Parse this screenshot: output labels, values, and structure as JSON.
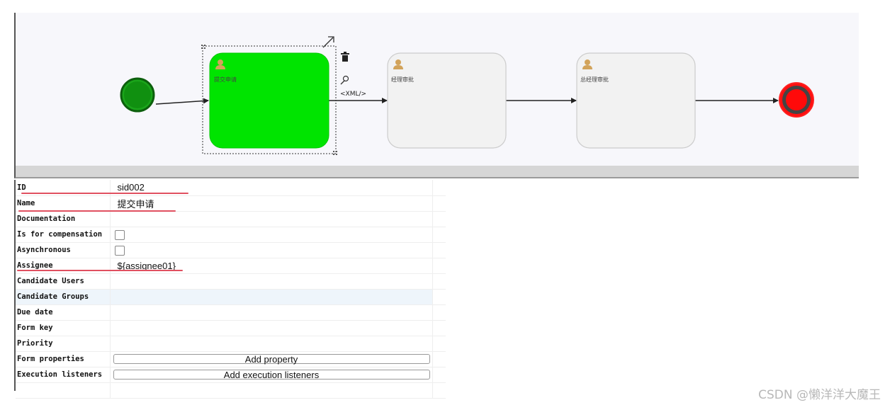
{
  "diagram": {
    "start_event_color": "#1aa51a",
    "end_event_color": "#ff1010",
    "selected_task_color": "#00e400",
    "tasks": [
      {
        "label": "提交申请",
        "selected": true
      },
      {
        "label": "经理审批",
        "selected": false
      },
      {
        "label": "总经理审批",
        "selected": false
      }
    ],
    "context_pad": {
      "xml_label": "<XML/>",
      "icons": [
        "trash-icon",
        "wrench-icon",
        "resize-arrow-icon"
      ]
    }
  },
  "properties": {
    "rows": [
      {
        "key": "ID",
        "value": "sid002"
      },
      {
        "key": "Name",
        "value": "提交申请"
      },
      {
        "key": "Documentation",
        "value": ""
      },
      {
        "key": "Is for compensation",
        "checkbox": false
      },
      {
        "key": "Asynchronous",
        "checkbox": false
      },
      {
        "key": "Assignee",
        "value": "${assignee01}"
      },
      {
        "key": "Candidate Users",
        "value": ""
      },
      {
        "key": "Candidate Groups",
        "value": "",
        "highlighted": true
      },
      {
        "key": "Due date",
        "value": ""
      },
      {
        "key": "Form key",
        "value": ""
      },
      {
        "key": "Priority",
        "value": ""
      },
      {
        "key": "Form properties",
        "button": "Add property"
      },
      {
        "key": "Execution listeners",
        "button": "Add execution listeners"
      }
    ]
  },
  "watermark": "CSDN @懒洋洋大魔王"
}
